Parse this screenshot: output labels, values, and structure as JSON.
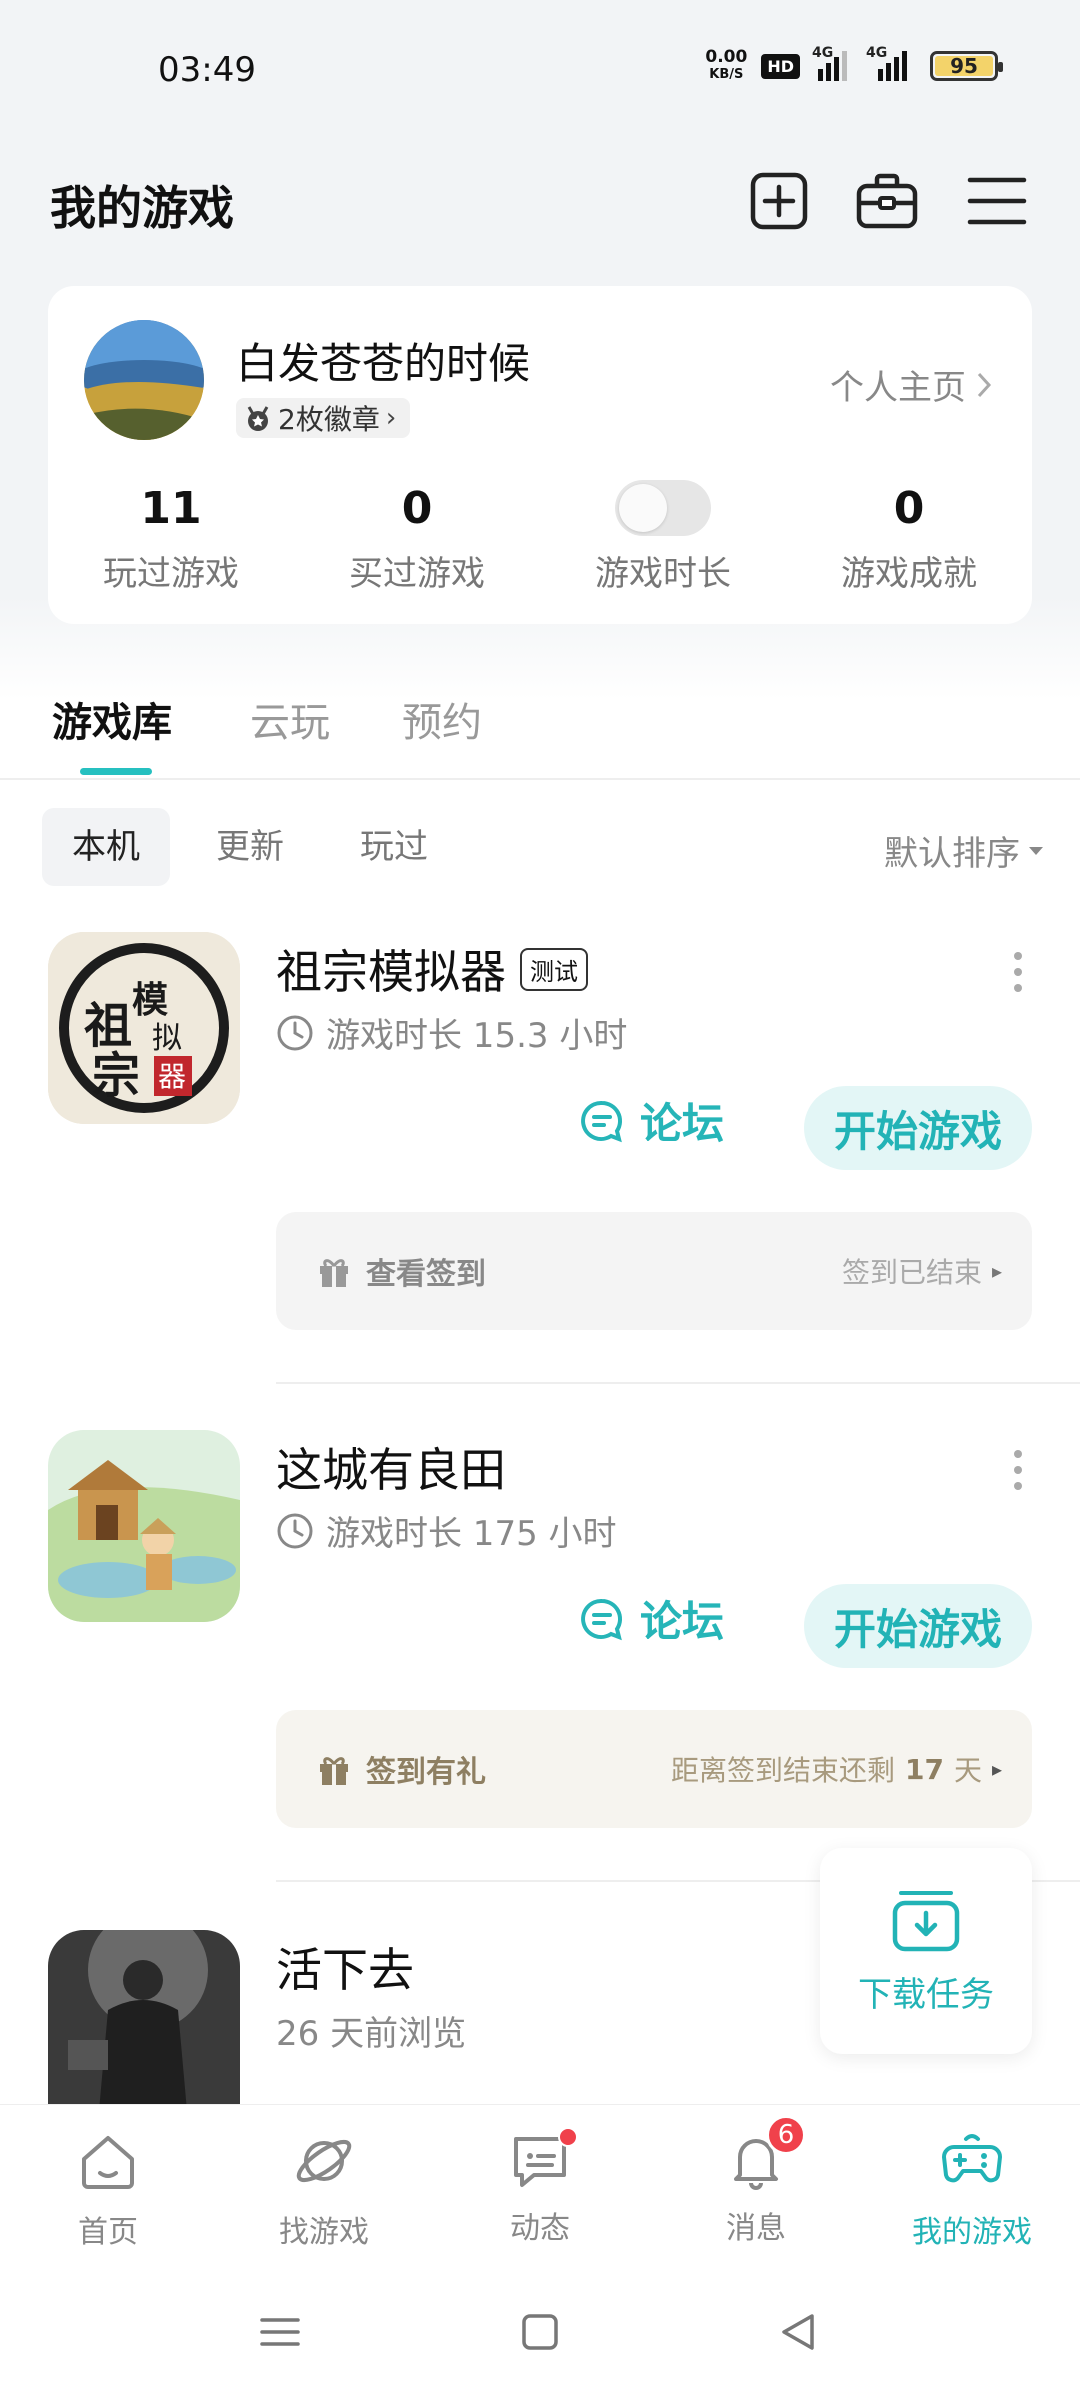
{
  "status_bar": {
    "time": "03:49",
    "net_speed_value": "0.00",
    "net_speed_unit": "KB/S",
    "hd": "HD",
    "network1": "4G",
    "network2": "4G",
    "battery": "95",
    "battery_color": "#f3d36a"
  },
  "header": {
    "title": "我的游戏",
    "icons": [
      "add-square-icon",
      "toolbox-icon",
      "menu-icon"
    ]
  },
  "profile": {
    "username": "白发苍苍的时候",
    "badges": "2枚徽章",
    "home_link": "个人主页",
    "stats": [
      {
        "value": "11",
        "label": "玩过游戏"
      },
      {
        "value": "0",
        "label": "买过游戏"
      },
      {
        "value": "",
        "label": "游戏时长"
      },
      {
        "value": "0",
        "label": "游戏成就"
      }
    ]
  },
  "tabs": [
    "游戏库",
    "云玩",
    "预约"
  ],
  "filters": [
    "本机",
    "更新",
    "玩过"
  ],
  "sort_label": "默认排序",
  "games": [
    {
      "name": "祖宗模拟器",
      "tag": "测试",
      "playtime": "游戏时长 15.3 小时",
      "forum": "论坛",
      "start": "开始游戏",
      "signin_left": "查看签到",
      "signin_right": "签到已结束"
    },
    {
      "name": "这城有良田",
      "playtime": "游戏时长 175 小时",
      "forum": "论坛",
      "start": "开始游戏",
      "signin_left": "签到有礼",
      "signin_right_prefix": "距离签到结束还剩",
      "signin_right_days": "17",
      "signin_right_suffix": "天"
    },
    {
      "name": "活下去",
      "playtime": "26 天前浏览"
    }
  ],
  "download_fab": "下载任务",
  "bottom_nav": [
    {
      "label": "首页",
      "icon": "home-icon"
    },
    {
      "label": "找游戏",
      "icon": "planet-icon"
    },
    {
      "label": "动态",
      "icon": "chat-icon"
    },
    {
      "label": "消息",
      "icon": "bell-icon",
      "badge": "6"
    },
    {
      "label": "我的游戏",
      "icon": "gamepad-icon"
    }
  ],
  "accent_color": "#22b3b6"
}
